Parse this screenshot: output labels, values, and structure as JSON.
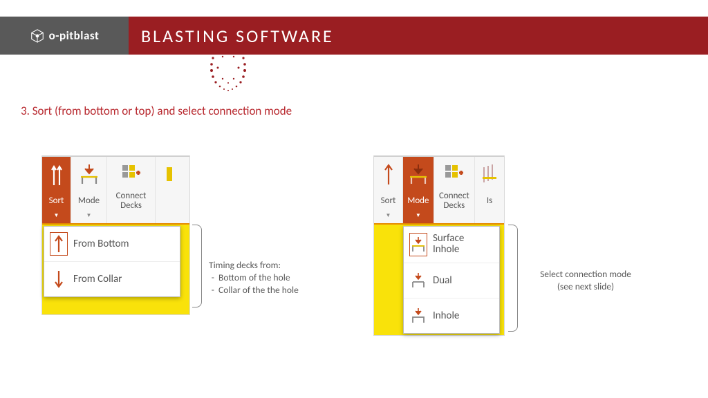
{
  "header": {
    "brand_prefix": "o-",
    "brand_name": "pitblast",
    "title": "BLASTING SOFTWARE"
  },
  "step_title": "3. Sort (from bottom or top) and select connection mode",
  "ribbon": {
    "sort": "Sort",
    "mode": "Mode",
    "connect": "Connect Decks",
    "iso_partial": "Is"
  },
  "sort_dropdown": {
    "from_bottom": "From Bottom",
    "from_collar": "From Collar"
  },
  "mode_dropdown": {
    "surface_inhole": "Surface Inhole",
    "dual": "Dual",
    "inhole": "Inhole"
  },
  "captions": {
    "left_title": "Timing decks from:",
    "left_item1": "Bottom of the hole",
    "left_item2": "Collar of the the hole",
    "right_line1": "Select connection mode",
    "right_line2": "(see next slide)"
  }
}
